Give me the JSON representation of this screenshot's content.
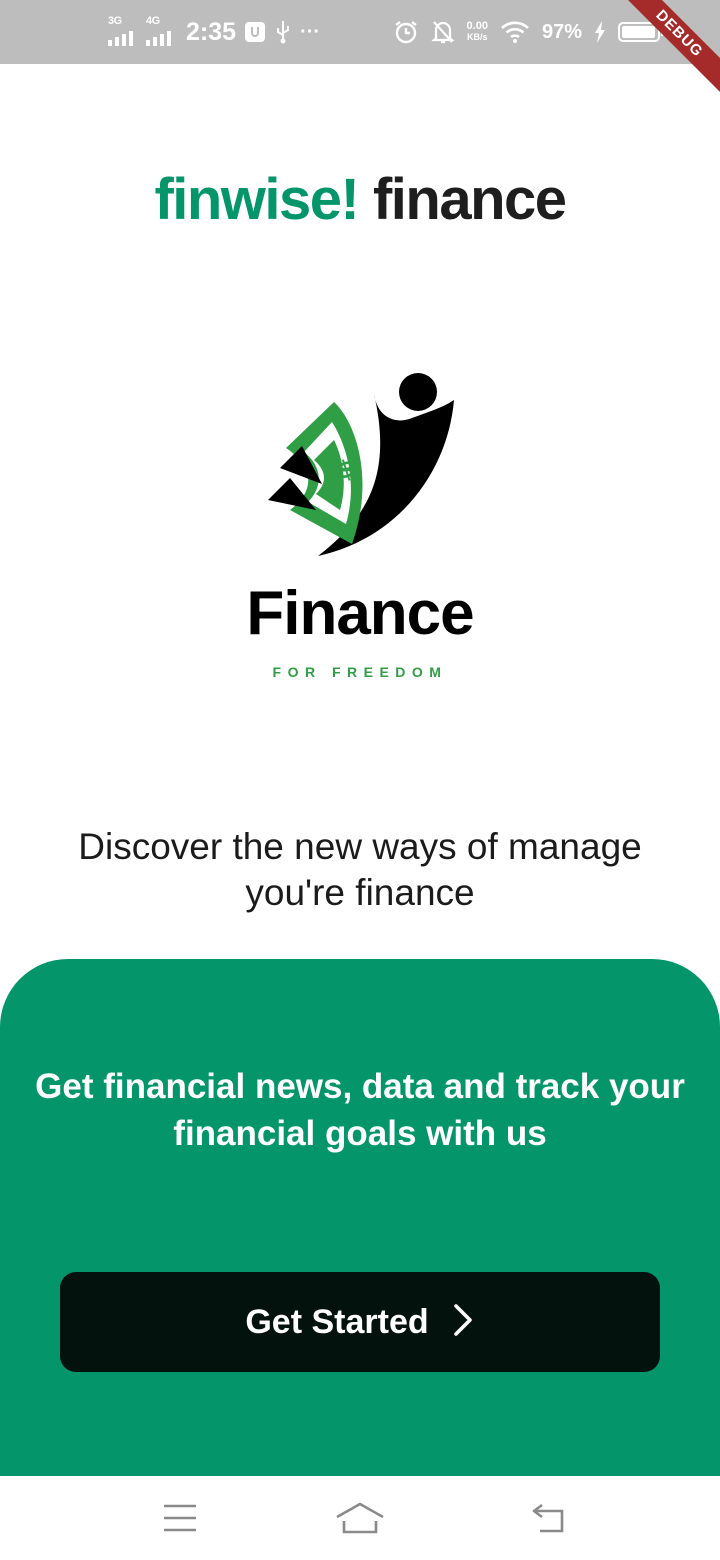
{
  "status_bar": {
    "signal_1": "3G",
    "signal_2": "4G",
    "time": "2:35",
    "more": "···",
    "net_speed_value": "0.00",
    "net_speed_unit": "KB/s",
    "battery_percent": "97%",
    "icons": [
      "sim-signal-icon",
      "usb-debug-icon",
      "usb-icon",
      "alarm-icon",
      "notifications-off-icon",
      "wifi-icon",
      "charging-icon",
      "battery-icon"
    ]
  },
  "debug_banner": "DEBUG",
  "brand": {
    "part1": "finwise!",
    "part2": "finance"
  },
  "logo": {
    "word": "Finance",
    "tagline": "FOR FREEDOM"
  },
  "headline": "Discover the new ways of manage you're finance",
  "panel": {
    "text": "Get financial news, data and track your financial goals with us",
    "cta_label": "Get Started",
    "cta_icon": "chevron-right-icon"
  },
  "nav": {
    "icons": [
      "menu-icon",
      "home-icon",
      "back-icon"
    ]
  },
  "colors": {
    "brand_green": "#04966a",
    "button_dark": "#04120d",
    "status_bar": "#bdbdbd",
    "debug_ribbon": "#a52a2a",
    "logo_green": "#2f9e45"
  }
}
